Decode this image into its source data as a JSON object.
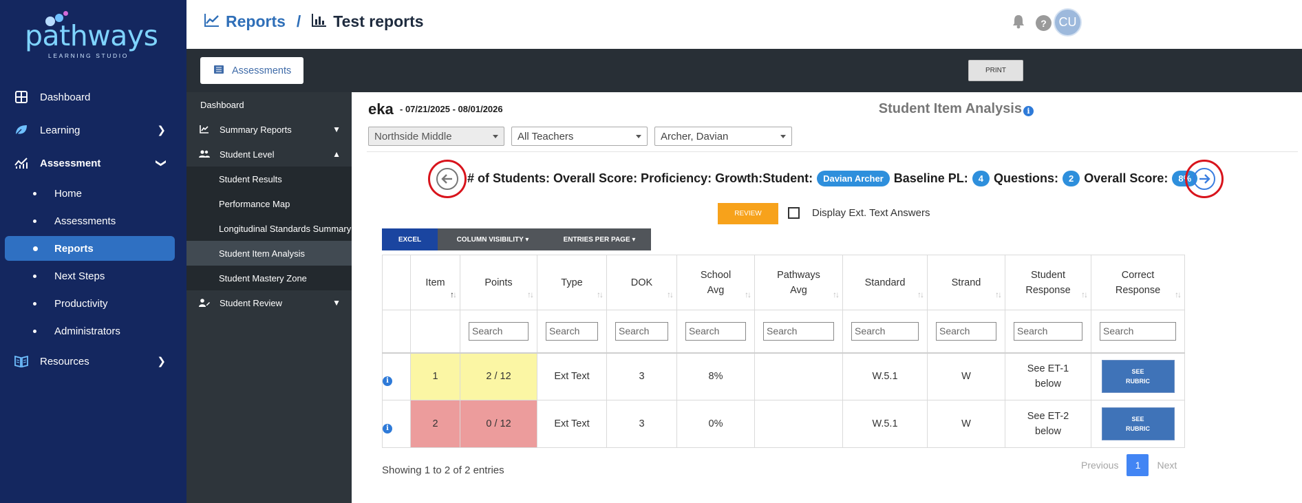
{
  "brand": {
    "name": "pathways",
    "tagline": "LEARNING STUDIO"
  },
  "nav": {
    "dashboard": "Dashboard",
    "learning": "Learning",
    "assessment": "Assessment",
    "sub": [
      "Home",
      "Assessments",
      "Reports",
      "Next Steps",
      "Productivity",
      "Administrators"
    ],
    "resources": "Resources"
  },
  "header": {
    "crumb1": "Reports",
    "separator": "/",
    "crumb2": "Test reports",
    "avatar": "CU",
    "help": "?"
  },
  "toolbar": {
    "assessments": "Assessments",
    "print": "PRINT"
  },
  "sidebar2": {
    "dashboard": "Dashboard",
    "summary_reports": "Summary Reports",
    "student_level": "Student Level",
    "children": [
      "Student Results",
      "Performance Map",
      "Longitudinal Standards Summary",
      "Student Item Analysis",
      "Student Mastery Zone"
    ],
    "student_review": "Student Review"
  },
  "main": {
    "name": "eka",
    "dates": "- 07/21/2025 - 08/01/2026",
    "heading": "Student Item Analysis",
    "filters": {
      "school": "Northside Middle",
      "teachers": "All Teachers",
      "student": "Archer, Davian"
    },
    "summary": {
      "text1": "# of Students: Overall Score: Proficiency: Growth:Student:",
      "student": "Davian Archer",
      "baseline_label": "Baseline PL:",
      "baseline": "4",
      "questions_label": "Questions:",
      "questions": "2",
      "overall_label": "Overall Score:",
      "overall": "8%"
    },
    "review": "REVIEW",
    "display_ext": "Display Ext. Text Answers",
    "buttons": {
      "excel": "EXCEL",
      "colvis": "COLUMN VISIBILITY ▾",
      "epp": "ENTRIES PER PAGE ▾"
    },
    "columns": {
      "item": "Item",
      "points": "Points",
      "type": "Type",
      "dok": "DOK",
      "school_avg1": "School",
      "school_avg2": "Avg",
      "pathways_avg1": "Pathways",
      "pathways_avg2": "Avg",
      "standard": "Standard",
      "strand": "Strand",
      "student_resp1": "Student",
      "student_resp2": "Response",
      "correct_resp1": "Correct",
      "correct_resp2": "Response"
    },
    "search_placeholder": "Search",
    "rows": [
      {
        "item": "1",
        "points": "2 / 12",
        "type": "Ext Text",
        "dok": "3",
        "school_avg": "8%",
        "pathways_avg": "",
        "standard": "W.5.1",
        "strand": "W",
        "resp1": "See ET-1",
        "resp2": "below",
        "btn1": "SEE",
        "btn2": "RUBRIC"
      },
      {
        "item": "2",
        "points": "0 / 12",
        "type": "Ext Text",
        "dok": "3",
        "school_avg": "0%",
        "pathways_avg": "",
        "standard": "W.5.1",
        "strand": "W",
        "resp1": "See ET-2",
        "resp2": "below",
        "btn1": "SEE",
        "btn2": "RUBRIC"
      }
    ],
    "showing": "Showing 1 to 2 of 2 entries",
    "pager": {
      "previous": "Previous",
      "page": "1",
      "next": "Next"
    }
  }
}
